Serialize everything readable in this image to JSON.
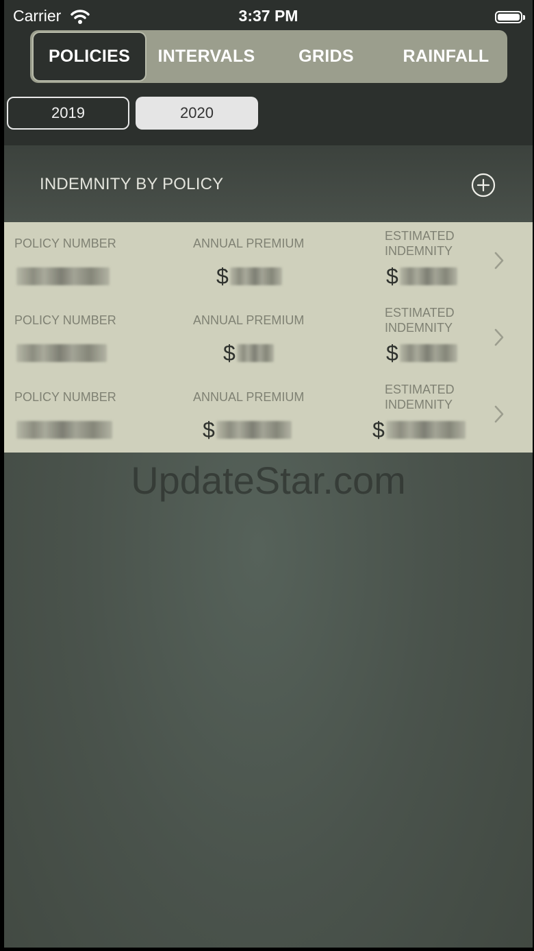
{
  "status_bar": {
    "carrier": "Carrier",
    "time": "3:37 PM"
  },
  "tabs": [
    {
      "label": "POLICIES",
      "selected": true
    },
    {
      "label": "INTERVALS",
      "selected": false
    },
    {
      "label": "GRIDS",
      "selected": false
    },
    {
      "label": "RAINFALL",
      "selected": false
    }
  ],
  "years": [
    {
      "label": "2019",
      "selected": false
    },
    {
      "label": "2020",
      "selected": true
    }
  ],
  "section": {
    "title": "INDEMNITY BY POLICY",
    "add_icon": "plus-circle-icon"
  },
  "policies": [
    {
      "policy_label": "POLICY NUMBER",
      "premium_label": "ANNUAL PREMIUM",
      "indemnity_label": "ESTIMATED INDEMNITY",
      "premium_currency": "$",
      "indemnity_currency": "$"
    },
    {
      "policy_label": "POLICY NUMBER",
      "premium_label": "ANNUAL PREMIUM",
      "indemnity_label": "ESTIMATED INDEMNITY",
      "premium_currency": "$",
      "indemnity_currency": "$"
    },
    {
      "policy_label": "POLICY NUMBER",
      "premium_label": "ANNUAL PREMIUM",
      "indemnity_label": "ESTIMATED INDEMNITY",
      "premium_currency": "$",
      "indemnity_currency": "$"
    }
  ],
  "watermark": "UpdateStar.com",
  "colors": {
    "dark": "#2c302d",
    "list_bg": "#cfd0bc",
    "tab_bar": "#9b9e8d"
  }
}
